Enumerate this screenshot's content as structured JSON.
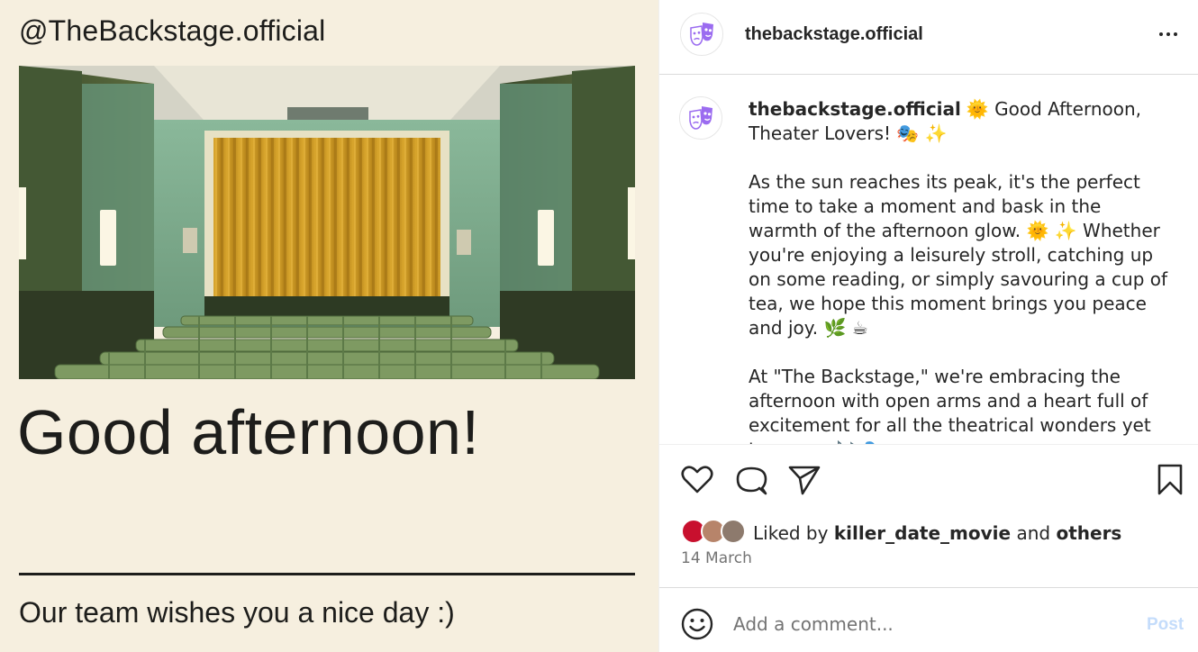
{
  "post_image": {
    "handle": "@TheBackstage.official",
    "headline": "Good afternoon!",
    "tagline": "Our team wishes you a nice day :)",
    "photo_subject": "cinema-auditorium-photo"
  },
  "header": {
    "username": "thebackstage.official",
    "more_icon": "more-horizontal-icon"
  },
  "caption": {
    "username": "thebackstage.official",
    "paragraphs": [
      "🌞 Good Afternoon, Theater Lovers! 🎭 ✨",
      "As the sun reaches its peak, it's the perfect time to take a moment and bask in the warmth of the afternoon glow. 🌞 ✨ Whether you're enjoying a leisurely stroll, catching up on some reading, or simply savouring a cup of tea, we hope this moment brings you peace and joy. 🌿 ☕",
      "At \"The Backstage,\" we're embracing the afternoon with open arms and a heart full of excitement for all the theatrical wonders yet to come. 🎶 🎭"
    ]
  },
  "actions": {
    "like_icon": "heart-icon",
    "comment_icon": "comment-icon",
    "share_icon": "paper-plane-icon",
    "save_icon": "bookmark-icon"
  },
  "likes": {
    "prefix": "Liked by",
    "user": "killer_date_movie",
    "joiner": "and",
    "others": "others"
  },
  "date": "14 March",
  "comment": {
    "placeholder": "Add a comment...",
    "post_label": "Post",
    "emoji_icon": "smiley-icon"
  },
  "colors": {
    "background_cream": "#f6efdf",
    "post_button_disabled": "#c4dcfb",
    "avatar_purple": "#9b6cf0"
  }
}
